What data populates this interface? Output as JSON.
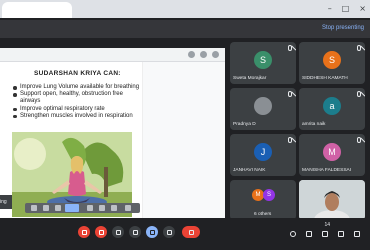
{
  "banner": {
    "stop_label": "Stop presenting"
  },
  "slide": {
    "title": "SUDARSHAN KRIYA CAN:",
    "bullets": [
      "Improve Lung Volume available for breathing",
      "Support open, healthy, obstruction free airways",
      "Improve optimal respiratory rate",
      "Strengthen muscles involved in respiration"
    ]
  },
  "pinned_label": "ing",
  "participants": [
    {
      "name": "Sweta Morajkar",
      "initial": "S",
      "color": "#3a8f6a"
    },
    {
      "name": "SIDDHESH KAMATH",
      "initial": "S",
      "color": "#e8711a"
    },
    {
      "name": "Pradnya D",
      "initial": "",
      "color": ""
    },
    {
      "name": "amrita naik",
      "initial": "a",
      "color": "#1c7d8c"
    },
    {
      "name": "JANHAVI NAIK",
      "initial": "J",
      "color": "#1a5fb4"
    },
    {
      "name": "MANISHA FALDESSAI",
      "initial": "M",
      "color": "#d061a6"
    }
  ],
  "others": {
    "label": "6 others",
    "avatars": [
      {
        "initial": "M",
        "color": "#e8711a"
      },
      {
        "initial": "S",
        "color": "#9334e6"
      }
    ]
  },
  "participant_count": "14",
  "icons": {
    "mic": "mic-off-icon",
    "camera": "camera-off-icon",
    "captions": "captions-icon",
    "raise_hand": "raise-hand-icon",
    "present": "present-icon",
    "more": "more-options-icon",
    "end": "end-call-icon",
    "info": "info-icon",
    "people": "people-icon",
    "chat": "chat-icon",
    "activities": "activities-icon",
    "lock": "lock-icon"
  }
}
